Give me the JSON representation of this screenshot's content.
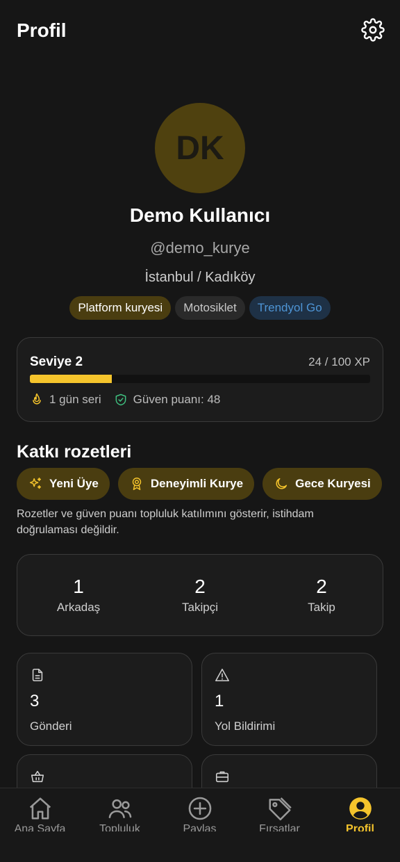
{
  "header": {
    "title": "Profil",
    "settings_icon": "gear-icon"
  },
  "profile": {
    "initials": "DK",
    "name": "Demo Kullanıcı",
    "handle": "@demo_kurye",
    "location": "İstanbul / Kadıköy",
    "tags": [
      "Platform kuryesi",
      "Motosiklet",
      "Trendyol Go"
    ]
  },
  "level": {
    "label": "Seviye 2",
    "xp": "24 / 100 XP",
    "progress": 0.24,
    "streak": "1 gün seri",
    "trust": "Güven puanı: 48"
  },
  "badges": {
    "title": "Katkı rozetleri",
    "items": [
      {
        "label": "Yeni Üye",
        "icon": "sparkles-icon"
      },
      {
        "label": "Deneyimli Kurye",
        "icon": "award-icon"
      },
      {
        "label": "Gece Kuryesi",
        "icon": "moon-icon"
      }
    ],
    "note": "Rozetler ve güven puanı topluluk katılımını gösterir, istihdam doğrulaması değildir."
  },
  "social": {
    "friends": {
      "value": "1",
      "label": "Arkadaş"
    },
    "followers": {
      "value": "2",
      "label": "Takipçi"
    },
    "following": {
      "value": "2",
      "label": "Takip"
    }
  },
  "stats": {
    "posts": {
      "value": "3",
      "label": "Gönderi",
      "icon": "document-icon"
    },
    "road_reports": {
      "value": "1",
      "label": "Yol Bildirimi",
      "icon": "warning-icon"
    }
  },
  "nav": {
    "items": [
      {
        "label": "Ana Sayfa",
        "icon": "home-icon"
      },
      {
        "label": "Topluluk",
        "icon": "users-icon"
      },
      {
        "label": "Paylaş",
        "icon": "plus-circle-icon"
      },
      {
        "label": "Fırsatlar",
        "icon": "tag-icon"
      },
      {
        "label": "Profil",
        "icon": "user-circle-icon"
      }
    ]
  },
  "colors": {
    "accent": "#f5c42c",
    "background": "#161616",
    "card": "#1c1c1c"
  }
}
